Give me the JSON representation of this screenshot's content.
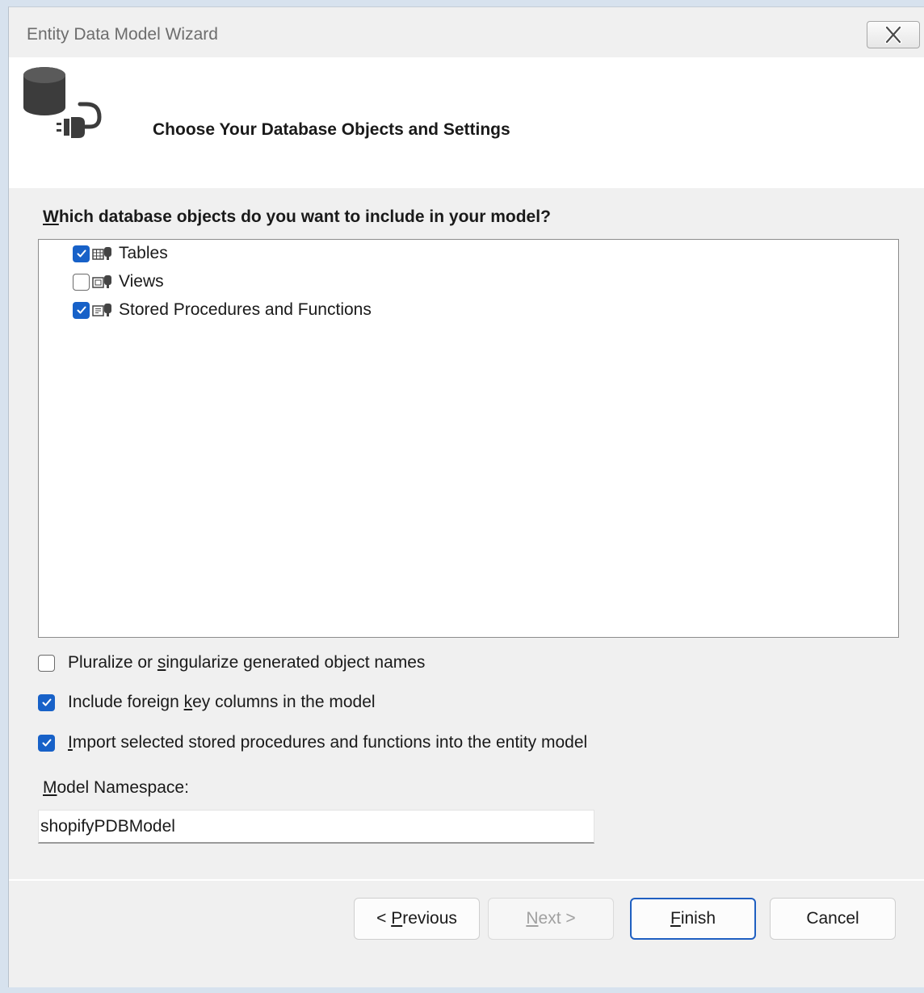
{
  "window": {
    "title": "Entity Data Model Wizard"
  },
  "header": {
    "title": "Choose Your Database Objects and Settings",
    "icon": "database-connection-icon"
  },
  "objects": {
    "question": "Which database objects do you want to include in your model?",
    "items": [
      {
        "label": "Tables",
        "checked": true,
        "icon": "tables-icon"
      },
      {
        "label": "Views",
        "checked": false,
        "icon": "views-icon"
      },
      {
        "label": "Stored Procedures and Functions",
        "checked": true,
        "icon": "stored-procedures-icon"
      }
    ]
  },
  "options": [
    {
      "label": "Pluralize or singularize generated object names",
      "checked": false
    },
    {
      "label": "Include foreign key columns in the model",
      "checked": true
    },
    {
      "label": "Import selected stored procedures and functions into the entity model",
      "checked": true
    }
  ],
  "namespace": {
    "label": "Model Namespace:",
    "value": "shopifyPDBModel"
  },
  "buttons": {
    "previous": "< Previous",
    "next": "Next >",
    "finish": "Finish",
    "cancel": "Cancel"
  },
  "colors": {
    "accent": "#1761c8",
    "default_button_border": "#1f5fc1"
  }
}
